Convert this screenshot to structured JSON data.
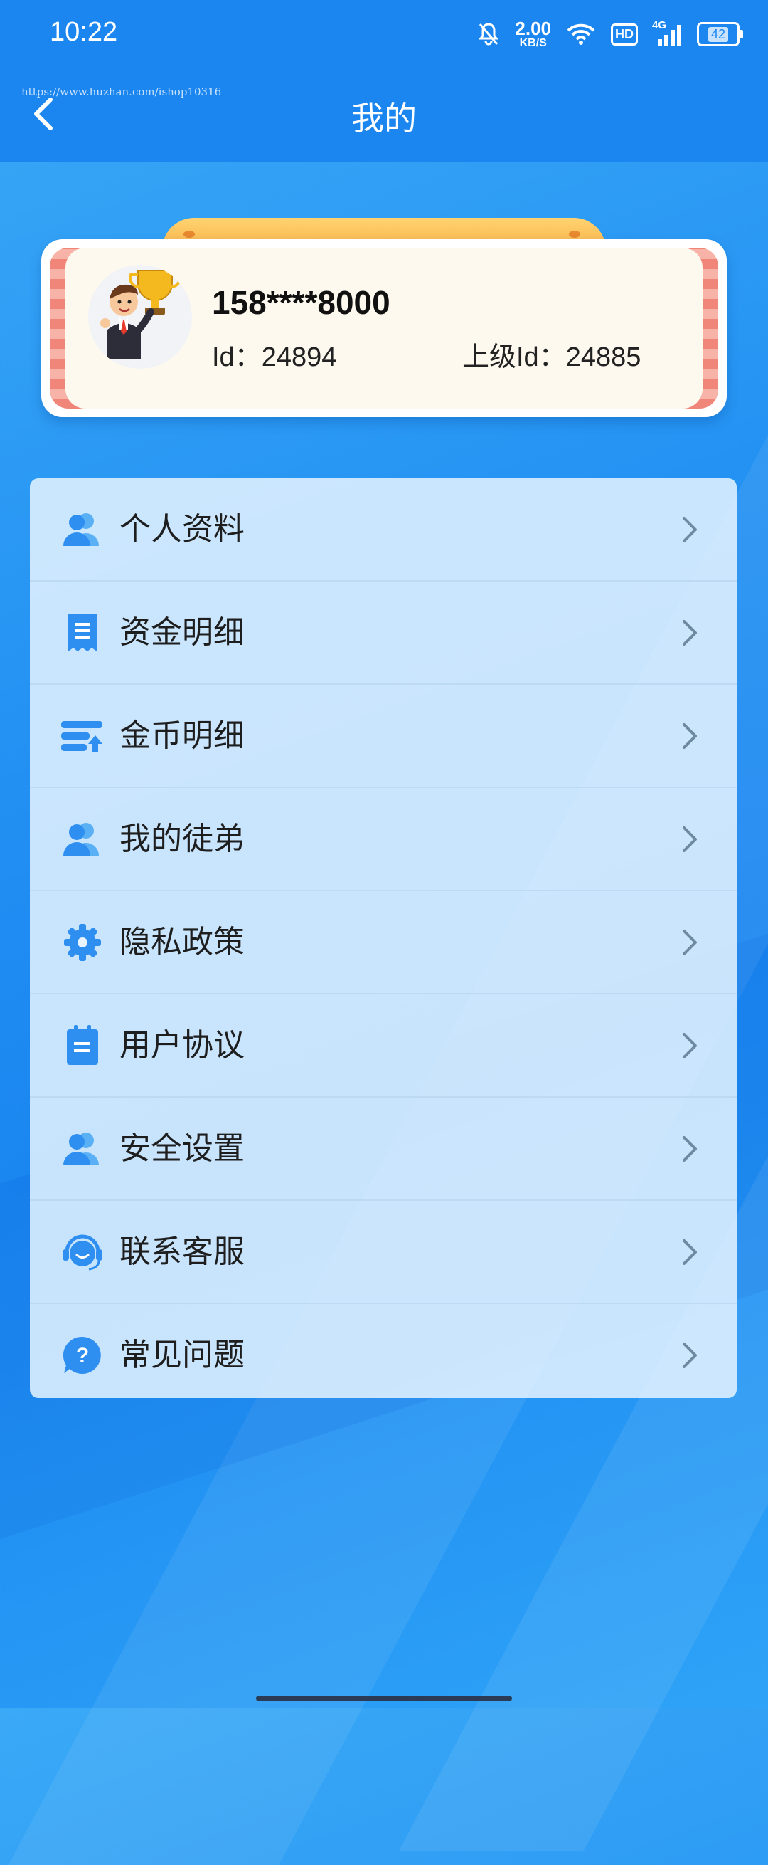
{
  "status_bar": {
    "time": "10:22",
    "net_speed_value": "2.00",
    "net_speed_unit": "KB/S",
    "hd_label": "HD",
    "network_label": "4G",
    "battery_level": "42"
  },
  "header": {
    "watermark": "https://www.huzhan.com/ishop10316",
    "title": "我的"
  },
  "profile": {
    "phone": "158****8000",
    "id_label": "Id：",
    "id_value": "24894",
    "parent_id_label": "上级Id：",
    "parent_id_value": "24885"
  },
  "menu": {
    "items": [
      {
        "label": "个人资料",
        "icon": "users-icon"
      },
      {
        "label": "资金明细",
        "icon": "receipt-icon"
      },
      {
        "label": "金币明细",
        "icon": "coin-stack-icon"
      },
      {
        "label": "我的徒弟",
        "icon": "users-icon"
      },
      {
        "label": "隐私政策",
        "icon": "gear-icon"
      },
      {
        "label": "用户协议",
        "icon": "notepad-icon"
      },
      {
        "label": "安全设置",
        "icon": "users-icon"
      },
      {
        "label": "联系客服",
        "icon": "headset-icon"
      },
      {
        "label": "常见问题",
        "icon": "question-icon"
      }
    ]
  },
  "colors": {
    "primary": "#1c86f0",
    "icon_blue": "#2f8ff0",
    "card_bg": "#fef9ee",
    "ribbon": "#f8b84a"
  }
}
